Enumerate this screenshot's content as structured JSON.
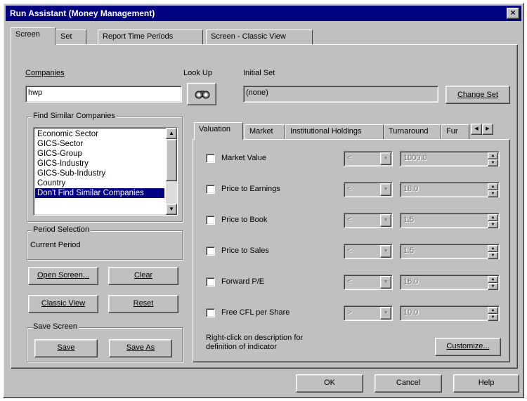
{
  "window": {
    "title": "Run Assistant   (Money Management)",
    "close_label": "×"
  },
  "tabs": [
    {
      "label": "Screen"
    },
    {
      "label": "Set"
    },
    {
      "label": "Report Time Periods"
    },
    {
      "label": "Screen - Classic View"
    }
  ],
  "companies": {
    "label": "Companies",
    "value": "hwp"
  },
  "lookup": {
    "label": "Look Up",
    "icon": "binoculars-icon"
  },
  "initial_set": {
    "label": "Initial Set",
    "value": "(none)",
    "change_label": "Change Set"
  },
  "find_similar": {
    "label": "Find Similar Companies",
    "items": [
      "Economic Sector",
      "GICS-Sector",
      "GICS-Group",
      "GICS-Industry",
      "GICS-Sub-Industry",
      "Country",
      "Don't Find Similar Companies"
    ],
    "selected_index": 6
  },
  "period": {
    "label": "Period Selection",
    "value": "Current Period"
  },
  "buttons": {
    "open_screen": "Open Screen...",
    "clear": "Clear",
    "classic_view": "Classic View",
    "reset": "Reset",
    "save": "Save",
    "save_as": "Save As"
  },
  "save_screen": {
    "label": "Save Screen"
  },
  "inner_tabs": [
    {
      "label": "Valuation"
    },
    {
      "label": "Market"
    },
    {
      "label": "Institutional Holdings"
    },
    {
      "label": "Turnaround"
    },
    {
      "label": "Fur"
    }
  ],
  "criteria": [
    {
      "label": "Market Value",
      "op": "<",
      "value": "1000.0"
    },
    {
      "label": "Price to Earnings",
      "op": "<",
      "value": "18.0"
    },
    {
      "label": "Price to Book",
      "op": "<",
      "value": "1.5"
    },
    {
      "label": "Price to Sales",
      "op": "<",
      "value": "1.5"
    },
    {
      "label": "Forward P/E",
      "op": "<",
      "value": "16.0"
    },
    {
      "label": "Free CFL per Share",
      "op": ">",
      "value": "10.0"
    }
  ],
  "hint": {
    "line1": "Right-click on description for",
    "line2": "definition of indicator"
  },
  "customize_label": "Customize...",
  "footer": {
    "ok": "OK",
    "cancel": "Cancel",
    "help": "Help"
  }
}
